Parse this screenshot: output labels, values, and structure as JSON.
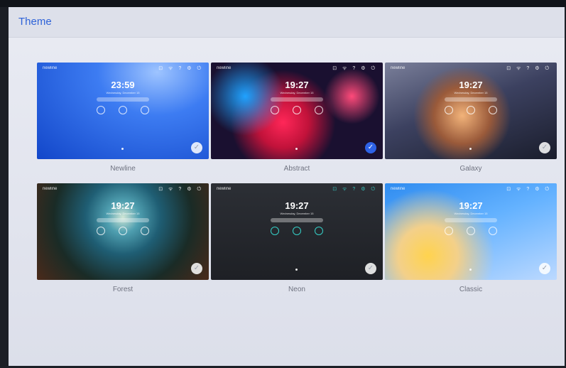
{
  "header": {
    "title": "Theme"
  },
  "themes": [
    {
      "name": "Newline",
      "brand": "newline",
      "time": "23:59",
      "date": "Wednesday, December 15",
      "selected": false
    },
    {
      "name": "Abstract",
      "brand": "newline",
      "time": "19:27",
      "date": "Wednesday, December 15",
      "selected": true
    },
    {
      "name": "Galaxy",
      "brand": "newline",
      "time": "19:27",
      "date": "Wednesday, December 15",
      "selected": false
    },
    {
      "name": "Forest",
      "brand": "newline",
      "time": "19:27",
      "date": "Wednesday, December 15",
      "selected": false
    },
    {
      "name": "Neon",
      "brand": "newline",
      "time": "19:27",
      "date": "Wednesday, December 15",
      "selected": false
    },
    {
      "name": "Classic",
      "brand": "newline",
      "time": "19:27",
      "date": "Wednesday, December 15",
      "selected": false
    }
  ],
  "status_icons": [
    "lock-icon",
    "wifi-icon",
    "help-icon",
    "settings-icon",
    "power-icon"
  ],
  "colors": {
    "accent": "#2e62e6",
    "title": "#2f63d8"
  }
}
